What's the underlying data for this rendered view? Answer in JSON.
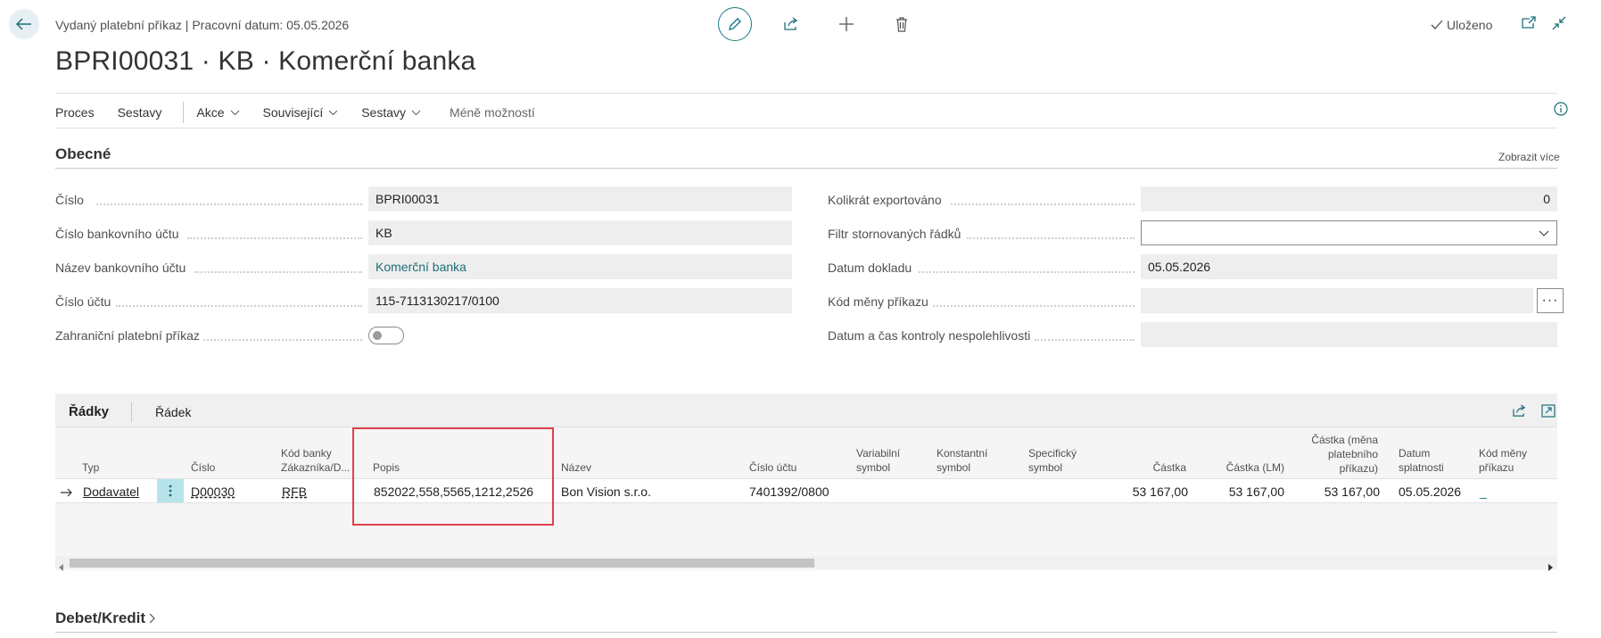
{
  "header": {
    "subtitle": "Vydaný platební příkaz | Pracovní datum: 05.05.2026",
    "title": "BPRI00031 · KB · Komerční banka",
    "saved_label": "Uloženo"
  },
  "actionbar": {
    "items": [
      "Proces",
      "Sestavy",
      "Akce",
      "Související",
      "Sestavy",
      "Méně možností"
    ]
  },
  "general": {
    "title": "Obecné",
    "show_more": "Zobrazit více",
    "left_fields": [
      {
        "label": "Číslo",
        "value": "BPRI00031"
      },
      {
        "label": "Číslo bankovního účtu",
        "value": "KB"
      },
      {
        "label": "Název bankovního účtu",
        "value": "Komerční banka"
      },
      {
        "label": "Číslo účtu",
        "value": "115-7113130217/0100"
      },
      {
        "label": "Zahraniční platební příkaz",
        "value": ""
      }
    ],
    "right_fields": [
      {
        "label": "Kolikrát exportováno",
        "value": "0"
      },
      {
        "label": "Filtr stornovaných řádků",
        "value": ""
      },
      {
        "label": "Datum dokladu",
        "value": "05.05.2026"
      },
      {
        "label": "Kód měny příkazu",
        "value": ""
      },
      {
        "label": "Datum a čas kontroly nespolehlivosti",
        "value": ""
      }
    ]
  },
  "lines": {
    "tab_lines": "Řádky",
    "tab_line": "Řádek",
    "columns": {
      "typ": "Typ",
      "cislo": "Číslo",
      "kod_banky_1": "Kód banky",
      "kod_banky_2": "Zákazníka/D...",
      "popis": "Popis",
      "nazev": "Název",
      "cislo_uctu": "Číslo účtu",
      "var_1": "Variabilní",
      "var_2": "symbol",
      "konst_1": "Konstantní",
      "konst_2": "symbol",
      "spec_1": "Specifický",
      "spec_2": "symbol",
      "castka": "Částka",
      "castka_lm": "Částka (LM)",
      "castka_mena_1": "Částka (měna",
      "castka_mena_2": "platebního",
      "castka_mena_3": "příkazu)",
      "datum_1": "Datum",
      "datum_2": "splatnosti",
      "kod_meny_1": "Kód měny",
      "kod_meny_2": "příkazu"
    },
    "row": {
      "typ": "Dodavatel",
      "cislo": "D00030",
      "kod_banky": "RFB",
      "popis": "852022,558,5565,1212,2526",
      "nazev": "Bon Vision s.r.o.",
      "cislo_uctu": "7401392/0800",
      "castka": "53 167,00",
      "castka_lm": "53 167,00",
      "castka_mena": "53 167,00",
      "datum": "05.05.2026",
      "kod_meny": "_"
    }
  },
  "footer": {
    "title": "Debet/Kredit"
  },
  "colors": {
    "accent": "#1c7a85",
    "highlight": "#e0404a"
  }
}
